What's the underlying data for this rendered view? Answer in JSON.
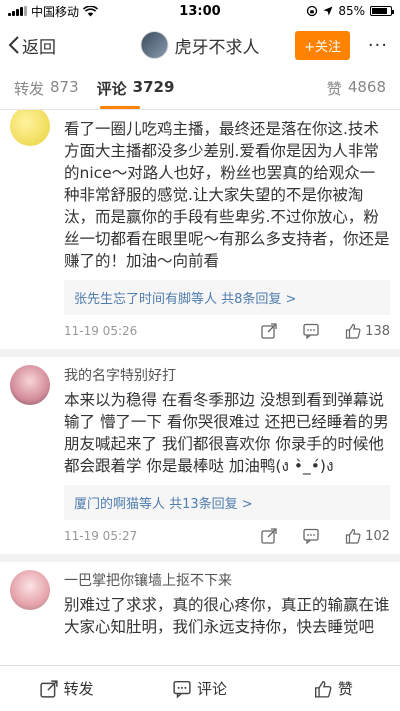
{
  "status": {
    "carrier": "中国移动",
    "time": "13:00",
    "battery": "85%",
    "battery_level": 0.85
  },
  "nav": {
    "back": "返回",
    "title": "虎牙不求人",
    "follow": "+关注",
    "more": "···"
  },
  "tabs": {
    "repost_label": "转发",
    "repost_count": "873",
    "comment_label": "评论",
    "comment_count": "3729",
    "like_label": "赞",
    "like_count": "4868"
  },
  "comments": [
    {
      "user": "",
      "text": "看了一圈儿吃鸡主播，最终还是落在你这.技术方面大主播都没多少差别.爱看你是因为人非常的nice～对路人也好，粉丝也罢真的给观众一种非常舒服的感觉.让大家失望的不是你被淘汰，而是赢你的手段有些卑劣.不过你放心，粉丝一切都看在眼里呢～有那么多支持者，你还是赚了的！加油～向前看",
      "replies_summary": "张先生忘了时间有脚等人  共8条回复 >",
      "time": "11-19 05:26",
      "likes": "138"
    },
    {
      "user": "我的名字特别好打",
      "text": "本来以为稳得 在看冬季那边 没想到看到弹幕说输了 懵了一下 看你哭很难过 还把已经睡着的男朋友喊起来了 我们都很喜欢你 你录手的时候他都会跟着学 你是最棒哒 加油鸭(ง •̀_•́)ง",
      "replies_summary": "厦门的啊猫等人  共13条回复 >",
      "time": "11-19 05:27",
      "likes": "102"
    },
    {
      "user": "一巴掌把你镶墙上抠不下来",
      "text": "别难过了求求，真的很心疼你，真正的输赢在谁大家心知肚明，我们永远支持你，快去睡觉吧",
      "replies_summary": "",
      "time": "",
      "likes": ""
    }
  ],
  "bottom": {
    "repost": "转发",
    "comment": "评论",
    "like": "赞"
  }
}
